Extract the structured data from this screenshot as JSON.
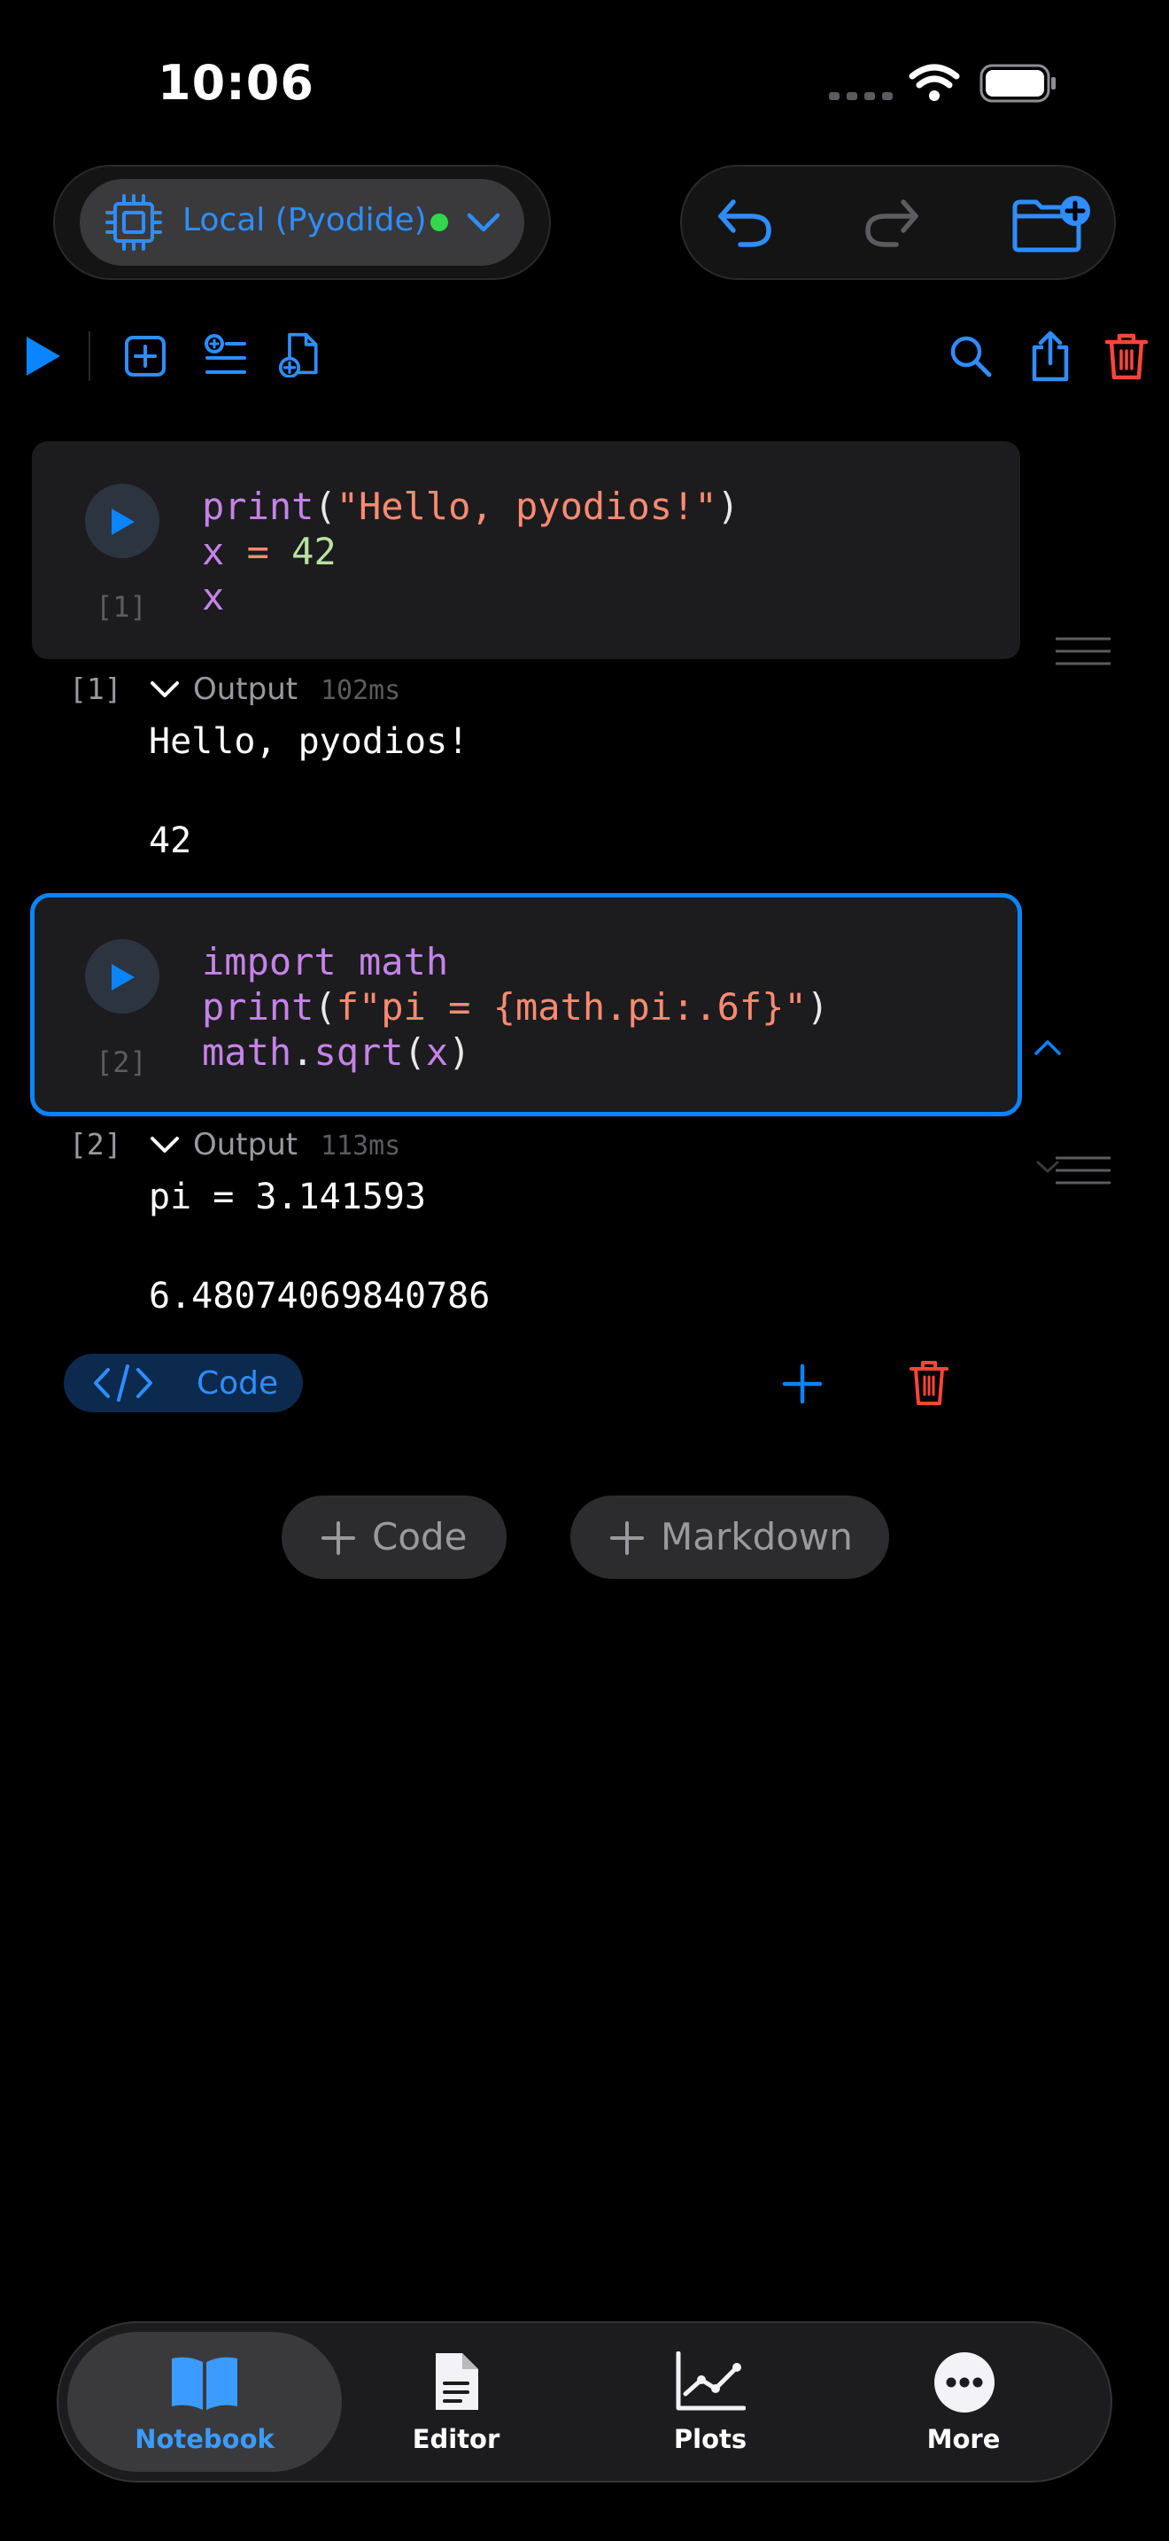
{
  "status_bar": {
    "time": "10:06"
  },
  "kernel": {
    "label": "Local (Pyodide)",
    "status_color": "#32d74b"
  },
  "colors": {
    "accent": "#0a84ff",
    "danger": "#ff453a"
  },
  "cells": [
    {
      "exec_label": "[1]",
      "code": {
        "l1a": "print",
        "l1b": "(",
        "l1c": "\"Hello, pyodios!\"",
        "l1d": ")",
        "l2a": "x",
        "l2b": " = ",
        "l2c": "42",
        "l3a": "x"
      },
      "output": {
        "count": "[1]",
        "label": "Output",
        "time": "102ms",
        "lines": [
          "Hello, pyodios!",
          "42"
        ]
      }
    },
    {
      "exec_label": "[2]",
      "code": {
        "l1a": "import math",
        "l2a": "print",
        "l2b": "(",
        "l2c": "f\"pi = {math.pi:.6f}\"",
        "l2d": ")",
        "l3a": "math",
        "l3b": ".",
        "l3c": "sqrt",
        "l3d": "(",
        "l3e": "x",
        "l3f": ")"
      },
      "output": {
        "count": "[2]",
        "label": "Output",
        "time": "113ms",
        "lines": [
          "pi = 3.141593",
          "6.48074069840786"
        ]
      }
    }
  ],
  "cell_type_label": "Code",
  "add_buttons": {
    "code": "Code",
    "markdown": "Markdown"
  },
  "tabs": [
    {
      "label": "Notebook",
      "icon": "book-icon",
      "active": true
    },
    {
      "label": "Editor",
      "icon": "document-icon",
      "active": false
    },
    {
      "label": "Plots",
      "icon": "chart-icon",
      "active": false
    },
    {
      "label": "More",
      "icon": "ellipsis-icon",
      "active": false
    }
  ]
}
